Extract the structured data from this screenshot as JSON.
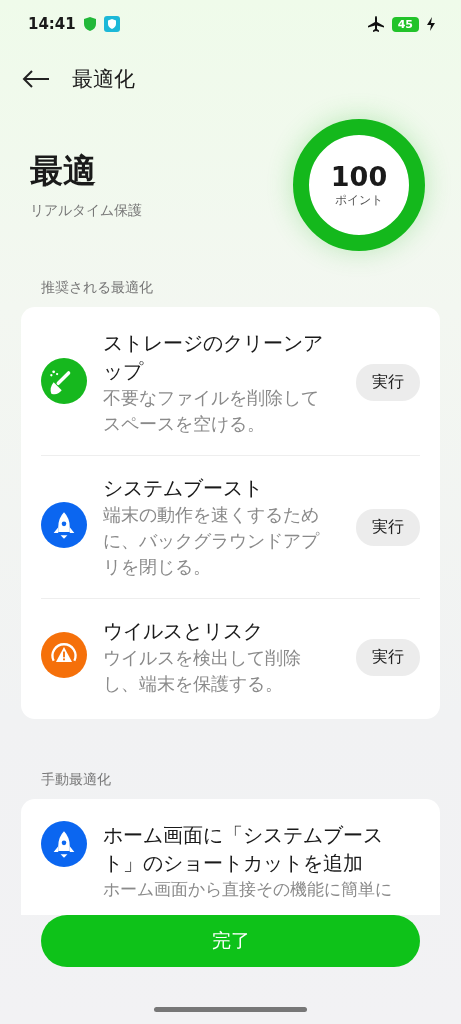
{
  "status_bar": {
    "time": "14:41",
    "battery": "45"
  },
  "header": {
    "title": "最適化"
  },
  "hero": {
    "status": "最適",
    "subtitle": "リアルタイム保護",
    "score": "100",
    "score_unit": "ポイント",
    "level": 1
  },
  "recommended": {
    "label": "推奨される最適化",
    "items": [
      {
        "kind": "storage",
        "color": "#16b81e",
        "title": "ストレージのクリーンアップ",
        "description": "不要なファイルを削除してスペースを空ける。",
        "action": "実行"
      },
      {
        "kind": "boost",
        "color": "#0b66f0",
        "title": "システムブースト",
        "description": "端末の動作を速くするために、バックグラウンドアプリを閉じる。",
        "action": "実行"
      },
      {
        "kind": "virus",
        "color": "#f5700a",
        "title": "ウイルスとリスク",
        "description": "ウイルスを検出して削除し、端末を保護する。",
        "action": "実行"
      }
    ]
  },
  "manual": {
    "label": "手動最適化",
    "items": [
      {
        "kind": "boost",
        "color": "#0b66f0",
        "title": "ホーム画面に「システムブースト」のショートカットを追加",
        "description": "ホーム画面から直接その機能に簡単に"
      }
    ]
  },
  "done_button": "完了"
}
